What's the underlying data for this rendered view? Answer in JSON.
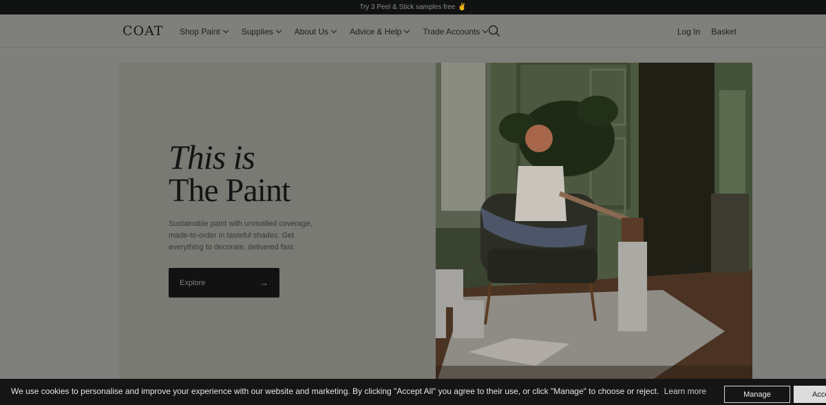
{
  "promo": {
    "text": "Try 3 Peel & Stick samples free",
    "emoji": "✌"
  },
  "header": {
    "logo": "COAT",
    "nav": [
      "Shop Paint",
      "Supplies",
      "About Us",
      "Advice & Help",
      "Trade Accounts"
    ],
    "login": "Log In",
    "basket": "Basket"
  },
  "hero": {
    "headline_line1": "This is",
    "headline_line2": "The Paint",
    "subtext": "Sustainable paint with unrivalled coverage, made-to-order in tasteful shades. Get everything to decorate, delivered fast.",
    "cta_label": "Explore",
    "cta_arrow": "→",
    "image_icon": "lifestyle-photo-woman-with-paint-tins"
  },
  "cookie": {
    "message": "We use cookies to personalise and improve your experience with our website and marketing. By clicking \"Accept All\" you agree to their use, or click \"Manage\" to choose or reject.",
    "learn_more": "Learn more",
    "manage_label": "Manage",
    "accept_label": "Accept All"
  },
  "colors": {
    "overlay_bg": "#7f7f7b",
    "dark": "#121212",
    "accent_wall": "#4f5a3e"
  }
}
